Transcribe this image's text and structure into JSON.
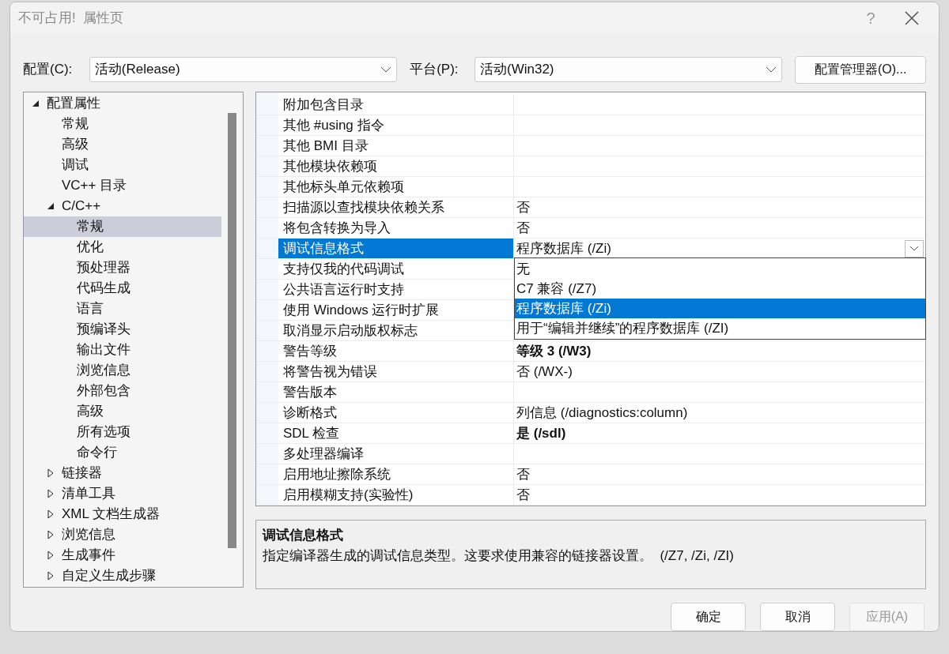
{
  "window": {
    "title": "不可占用!  属性页",
    "help": "?"
  },
  "config": {
    "label": "配置(C):",
    "value": "活动(Release)"
  },
  "platform": {
    "label": "平台(P):",
    "value": "活动(Win32)"
  },
  "config_manager": "配置管理器(O)...",
  "tree": [
    {
      "label": "配置属性",
      "expanded": true,
      "selected": false,
      "children": [
        {
          "label": "常规",
          "selected": false
        },
        {
          "label": "高级",
          "selected": false
        },
        {
          "label": "调试",
          "selected": false
        },
        {
          "label": "VC++ 目录",
          "selected": false
        },
        {
          "label": "C/C++",
          "expanded": true,
          "selected": false,
          "children": [
            {
              "label": "常规",
              "selected": true
            },
            {
              "label": "优化",
              "selected": false
            },
            {
              "label": "预处理器",
              "selected": false
            },
            {
              "label": "代码生成",
              "selected": false
            },
            {
              "label": "语言",
              "selected": false
            },
            {
              "label": "预编译头",
              "selected": false
            },
            {
              "label": "输出文件",
              "selected": false
            },
            {
              "label": "浏览信息",
              "selected": false
            },
            {
              "label": "外部包含",
              "selected": false
            },
            {
              "label": "高级",
              "selected": false
            },
            {
              "label": "所有选项",
              "selected": false
            },
            {
              "label": "命令行",
              "selected": false
            }
          ]
        },
        {
          "label": "链接器",
          "expanded": false,
          "selected": false
        },
        {
          "label": "清单工具",
          "expanded": false,
          "selected": false
        },
        {
          "label": "XML 文档生成器",
          "expanded": false,
          "selected": false
        },
        {
          "label": "浏览信息",
          "expanded": false,
          "selected": false
        },
        {
          "label": "生成事件",
          "expanded": false,
          "selected": false
        },
        {
          "label": "自定义生成步骤",
          "expanded": false,
          "selected": false
        }
      ]
    }
  ],
  "properties": [
    {
      "name": "附加包含目录",
      "selected": false
    },
    {
      "name": "其他 #using 指令",
      "selected": false
    },
    {
      "name": "其他 BMI 目录",
      "selected": false
    },
    {
      "name": "其他模块依赖项",
      "selected": false
    },
    {
      "name": "其他标头单元依赖项",
      "selected": false
    },
    {
      "name": "扫描源以查找模块依赖关系",
      "value": "否",
      "selected": false
    },
    {
      "name": "将包含转换为导入",
      "value": "否",
      "selected": false
    },
    {
      "name": "调试信息格式",
      "value": "程序数据库 (/Zi)",
      "selected": true
    },
    {
      "name": "支持仅我的代码调试",
      "selected": false
    },
    {
      "name": "公共语言运行时支持",
      "selected": false
    },
    {
      "name": "使用 Windows 运行时扩展",
      "selected": false
    },
    {
      "name": "取消显示启动版权标志",
      "selected": false
    },
    {
      "name": "警告等级",
      "value": "等级 3 (/W3)",
      "bold": true,
      "selected": false
    },
    {
      "name": "将警告视为错误",
      "value": "否 (/WX-)",
      "selected": false
    },
    {
      "name": "警告版本",
      "selected": false
    },
    {
      "name": "诊断格式",
      "value": "列信息 (/diagnostics:column)",
      "selected": false
    },
    {
      "name": "SDL 检查",
      "value": "是 (/sdl)",
      "bold": true,
      "selected": false
    },
    {
      "name": "多处理器编译",
      "selected": false
    },
    {
      "name": "启用地址擦除系统",
      "value": "否",
      "selected": false
    },
    {
      "name": "启用模糊支持(实验性)",
      "value": "否",
      "selected": false
    }
  ],
  "dropdown_options": [
    {
      "label": "无",
      "selected": false
    },
    {
      "label": "C7 兼容 (/Z7)",
      "selected": false
    },
    {
      "label": "程序数据库 (/Zi)",
      "selected": true
    },
    {
      "label": "用于“编辑并继续”的程序数据库 (/ZI)",
      "selected": false
    }
  ],
  "description": {
    "title": "调试信息格式",
    "text": "指定编译器生成的调试信息类型。这要求使用兼容的链接器设置。  (/Z7, /Zi, /ZI)"
  },
  "buttons": [
    {
      "label": "确定",
      "disabled": false
    },
    {
      "label": "取消",
      "disabled": false
    },
    {
      "label": "应用(A)",
      "disabled": true
    }
  ]
}
